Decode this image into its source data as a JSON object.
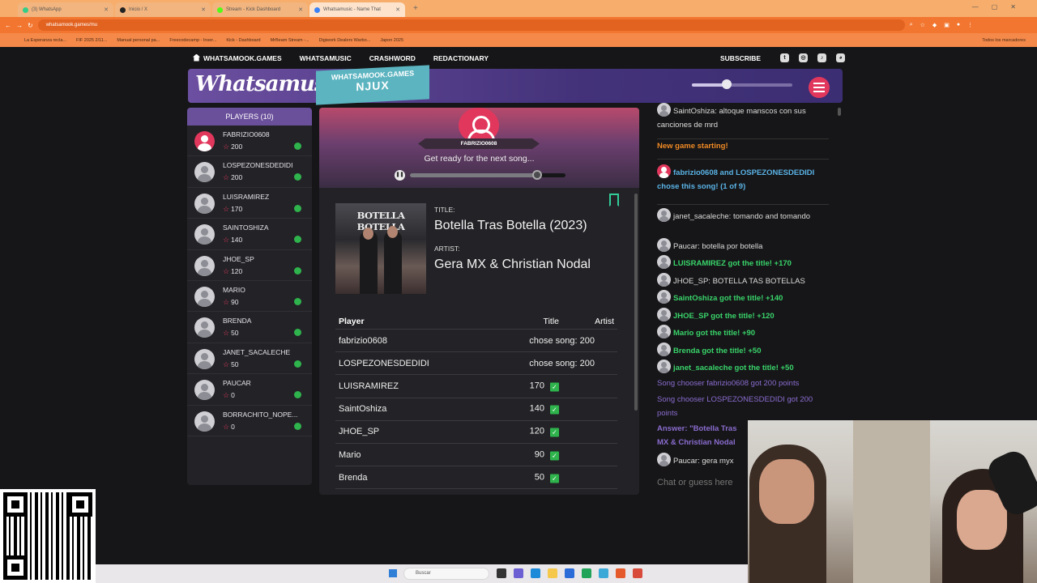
{
  "browser": {
    "tabs": [
      {
        "label": "(3) WhatsApp",
        "active": false,
        "color": "#25d366"
      },
      {
        "label": "Inicio / X",
        "active": false,
        "color": "#222222"
      },
      {
        "label": "Stream - Kick Dashboard",
        "active": false,
        "color": "#53fc18"
      },
      {
        "label": "Whatsamusic - Name That",
        "active": true,
        "color": "#3b82f6"
      }
    ],
    "url": "whatsamook.games/mu",
    "bookmarks": [
      "La Esperanza recla...",
      "FIF 2025 2/11...",
      "Manual personal pa...",
      "Freecodecamp - Inser...",
      "Kick - Dashboard",
      "MrBeam Stream -...",
      "Digiwork Dealers Warbo...",
      "Japon 2025"
    ],
    "bookmarks_right": "Todos los marcadores"
  },
  "nav": {
    "home": "WHATSAMOOK.GAMES",
    "links": [
      "WHATSAMUSIC",
      "CRASHWORD",
      "REDACTIONARY"
    ],
    "subscribe": "SUBSCRIBE",
    "social_icons": [
      "twitter-icon",
      "instagram-icon",
      "tiktok-icon",
      "discord-icon"
    ]
  },
  "header": {
    "logo": "Whatsamusic",
    "room_label": "WHATSAMOOK.GAMES",
    "room_code": "NJUX",
    "volume_level": 0.35
  },
  "players": {
    "title": "PLAYERS (10)",
    "list": [
      {
        "name": "FABRIZIO0608",
        "score": "200",
        "avatar": "pink"
      },
      {
        "name": "LOSPEZONESDEDIDI",
        "score": "200",
        "avatar": "gray"
      },
      {
        "name": "LUISRAMIREZ",
        "score": "170",
        "avatar": "gray"
      },
      {
        "name": "SAINTOSHIZA",
        "score": "140",
        "avatar": "gray"
      },
      {
        "name": "JHOE_SP",
        "score": "120",
        "avatar": "gray"
      },
      {
        "name": "MARIO",
        "score": "90",
        "avatar": "gray"
      },
      {
        "name": "BRENDA",
        "score": "50",
        "avatar": "gray"
      },
      {
        "name": "JANET_SACALECHE",
        "score": "50",
        "avatar": "gray"
      },
      {
        "name": "PAUCAR",
        "score": "0",
        "avatar": "gray"
      },
      {
        "name": "BORRACHITO_NOPE...",
        "score": "0",
        "avatar": "gray"
      }
    ]
  },
  "game": {
    "chooser": "FABRIZIO0608",
    "status": "Get ready for the next song...",
    "progress": 0.82,
    "album_text": "BOTELLA BOTELLA",
    "title_label": "TITLE:",
    "title": "Botella Tras Botella (2023)",
    "artist_label": "ARTIST:",
    "artist": "Gera MX & Christian Nodal",
    "table": {
      "headers": [
        "Player",
        "Title",
        "Artist"
      ],
      "rows": [
        {
          "player": "fabrizio0608",
          "title": "chose song: 200",
          "check": false
        },
        {
          "player": "LOSPEZONESDEDIDI",
          "title": "chose song: 200",
          "check": false
        },
        {
          "player": "LUISRAMIREZ",
          "title": "170",
          "check": true
        },
        {
          "player": "SaintOshiza",
          "title": "140",
          "check": true
        },
        {
          "player": "JHOE_SP",
          "title": "120",
          "check": true
        },
        {
          "player": "Mario",
          "title": "90",
          "check": true
        },
        {
          "player": "Brenda",
          "title": "50",
          "check": true
        }
      ]
    }
  },
  "chat": {
    "m0": "SaintOshiza: altoque manscos con sus canciones de mrd",
    "m1": "New game starting!",
    "m2": "fabrizio0608 and LOSPEZONESDEDIDI chose this song! (1 of 9)",
    "m3": "janet_sacaleche: tomando and tomando",
    "m4": "Paucar: botella por botella",
    "m5": "LUISRAMIREZ got the title! +170",
    "m6": "JHOE_SP: BOTELLA TAS BOTELLAS",
    "m7": "SaintOshiza got the title! +140",
    "m8": "JHOE_SP got the title! +120",
    "m9": "Mario got the title! +90",
    "m10": "Brenda got the title! +50",
    "m11": "janet_sacaleche got the title! +50",
    "m12": "Song chooser fabrizio0608 got 200 points",
    "m13": "Song chooser LOSPEZONESDEDIDI got 200 points",
    "m14a": "Answer: \"Botella Tras",
    "m14b": "MX & Christian Nodal",
    "m15": "Paucar: gera myx",
    "input_placeholder": "Chat or guess here"
  },
  "taskbar": {
    "search": "Buscar"
  },
  "colors": {
    "accent": "#e2375c",
    "purple": "#6a4f9b",
    "teal": "#5bb4c0",
    "green": "#2fb34c"
  }
}
